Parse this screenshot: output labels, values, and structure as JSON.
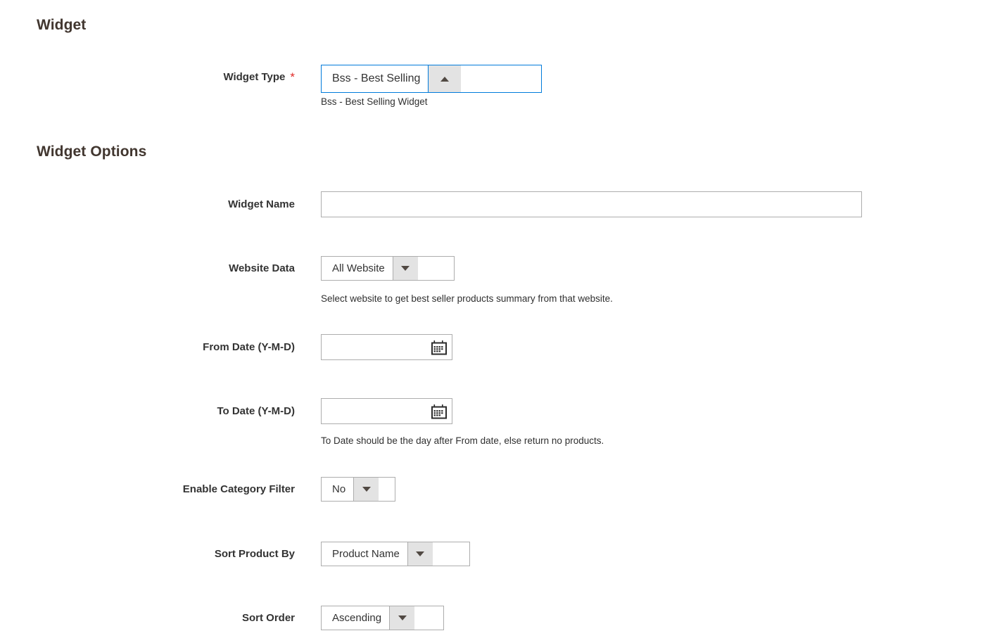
{
  "sections": {
    "widget_title": "Widget",
    "widget_options_title": "Widget Options"
  },
  "colors": {
    "focus_border": "#007bdb",
    "required_star": "#e02b27",
    "label_text": "#333333",
    "heading_text": "#41362f",
    "select_button_bg": "#e3e3e3",
    "field_border": "#adadad"
  },
  "fields": {
    "widget_type": {
      "label": "Widget Type",
      "required_marker": "*",
      "value": "Bss - Best Selling",
      "note": "Bss - Best Selling Widget",
      "arrow": "caret-up-icon"
    },
    "widget_name": {
      "label": "Widget Name",
      "value": "",
      "placeholder": ""
    },
    "website_data": {
      "label": "Website Data",
      "value": "All Website",
      "note": "Select website to get best seller products summary from that website.",
      "arrow": "caret-down-icon"
    },
    "from_date": {
      "label": "From Date (Y-M-D)",
      "value": "",
      "placeholder": "",
      "icon": "calendar-icon"
    },
    "to_date": {
      "label": "To Date (Y-M-D)",
      "value": "",
      "placeholder": "",
      "note": "To Date should be the day after From date, else return no products.",
      "icon": "calendar-icon"
    },
    "enable_category_filter": {
      "label": "Enable Category Filter",
      "value": "No",
      "arrow": "caret-down-icon"
    },
    "sort_product_by": {
      "label": "Sort Product By",
      "value": "Product Name",
      "arrow": "caret-down-icon"
    },
    "sort_order": {
      "label": "Sort Order",
      "value": "Ascending",
      "arrow": "caret-down-icon"
    }
  }
}
